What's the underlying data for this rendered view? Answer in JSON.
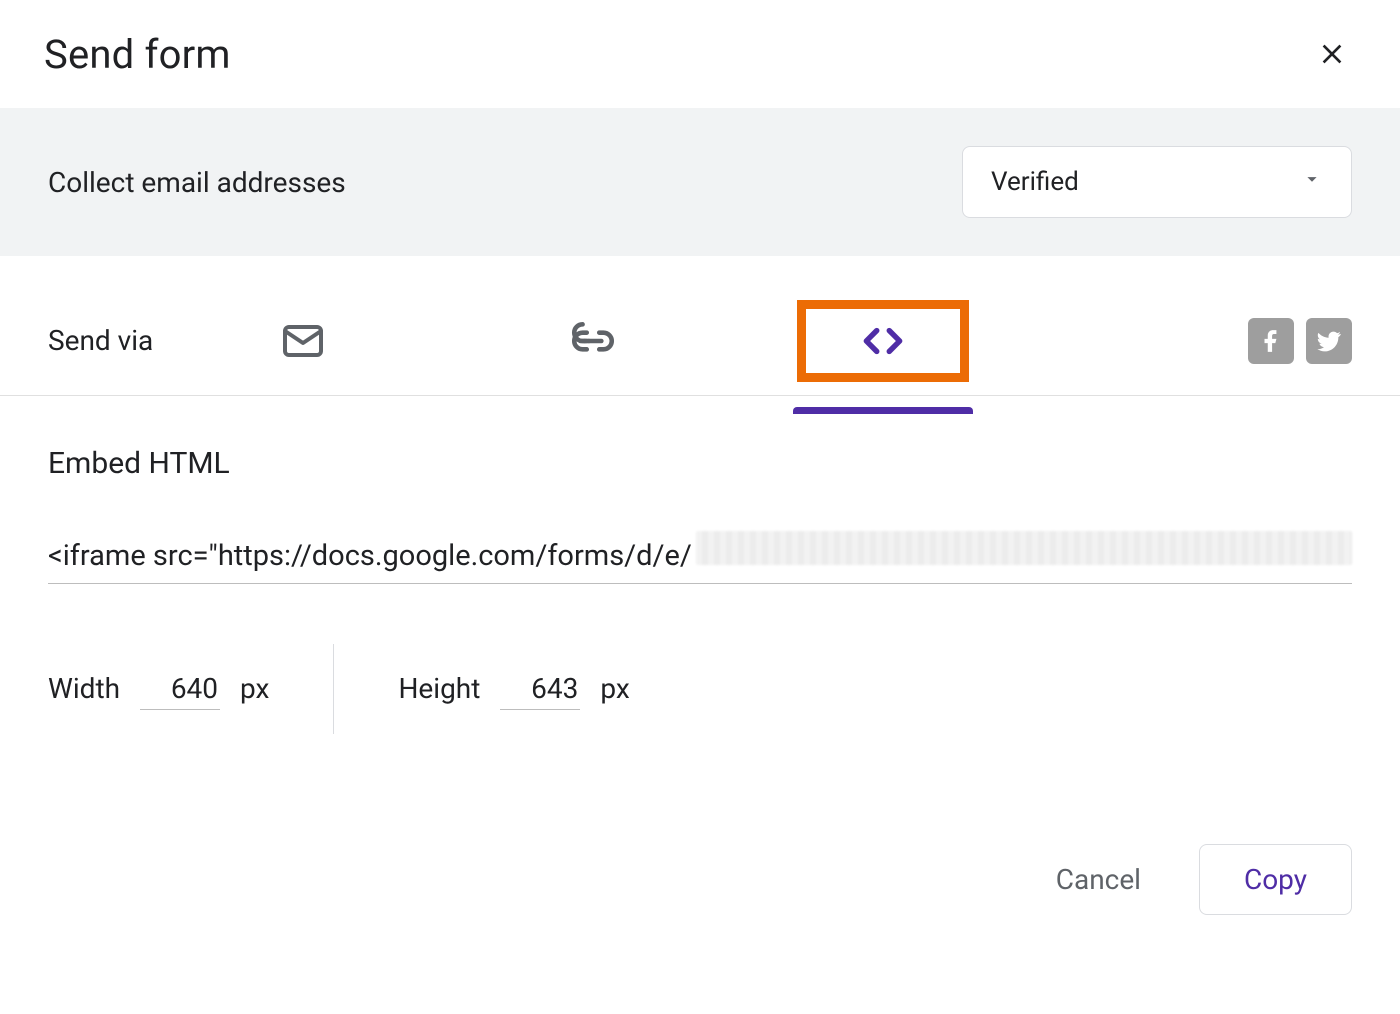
{
  "header": {
    "title": "Send form"
  },
  "collect": {
    "label": "Collect email addresses",
    "selected": "Verified"
  },
  "sendvia": {
    "label": "Send via"
  },
  "embed": {
    "heading": "Embed HTML",
    "code_visible": "<iframe src=\"https://docs.google.com/forms/d/e/"
  },
  "dimensions": {
    "width_label": "Width",
    "width_value": "640",
    "height_label": "Height",
    "height_value": "643",
    "unit": "px"
  },
  "footer": {
    "cancel": "Cancel",
    "copy": "Copy"
  }
}
